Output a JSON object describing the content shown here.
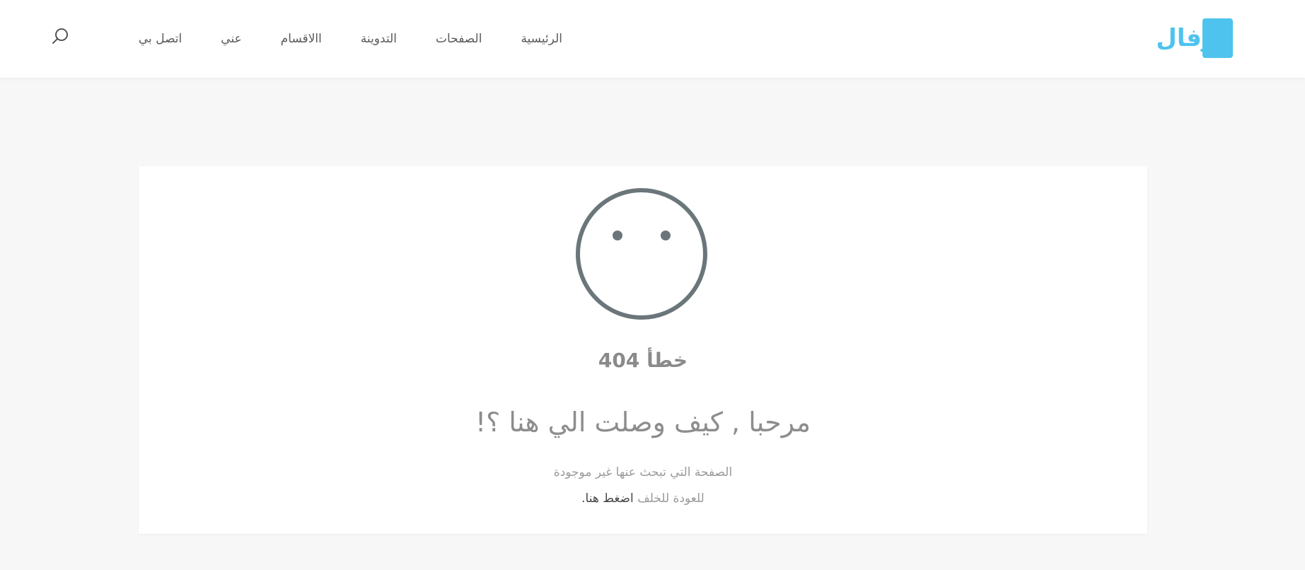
{
  "brand": {
    "logo_text": "نوفال",
    "accent_color": "#4ec3ee"
  },
  "nav": {
    "items": [
      {
        "label": "الرئيسية"
      },
      {
        "label": "الصفحات"
      },
      {
        "label": "التدوينة"
      },
      {
        "label": "االاقسام"
      },
      {
        "label": "عني"
      },
      {
        "label": "اتصل بي"
      }
    ],
    "search_icon": "search-icon"
  },
  "error": {
    "icon": "sad-face-icon",
    "code": "خطأ 404",
    "headline": "مرحبا , كيف وصلت الي هنا ؟!",
    "message": "الصفحة التي تبحث عنها غير موجودة",
    "back_prefix": "للعودة للخلف ",
    "back_link": "اضغط هنا."
  },
  "colors": {
    "page_bg": "#f7f7f7",
    "card_bg": "#ffffff",
    "face_stroke": "#6b767a"
  }
}
